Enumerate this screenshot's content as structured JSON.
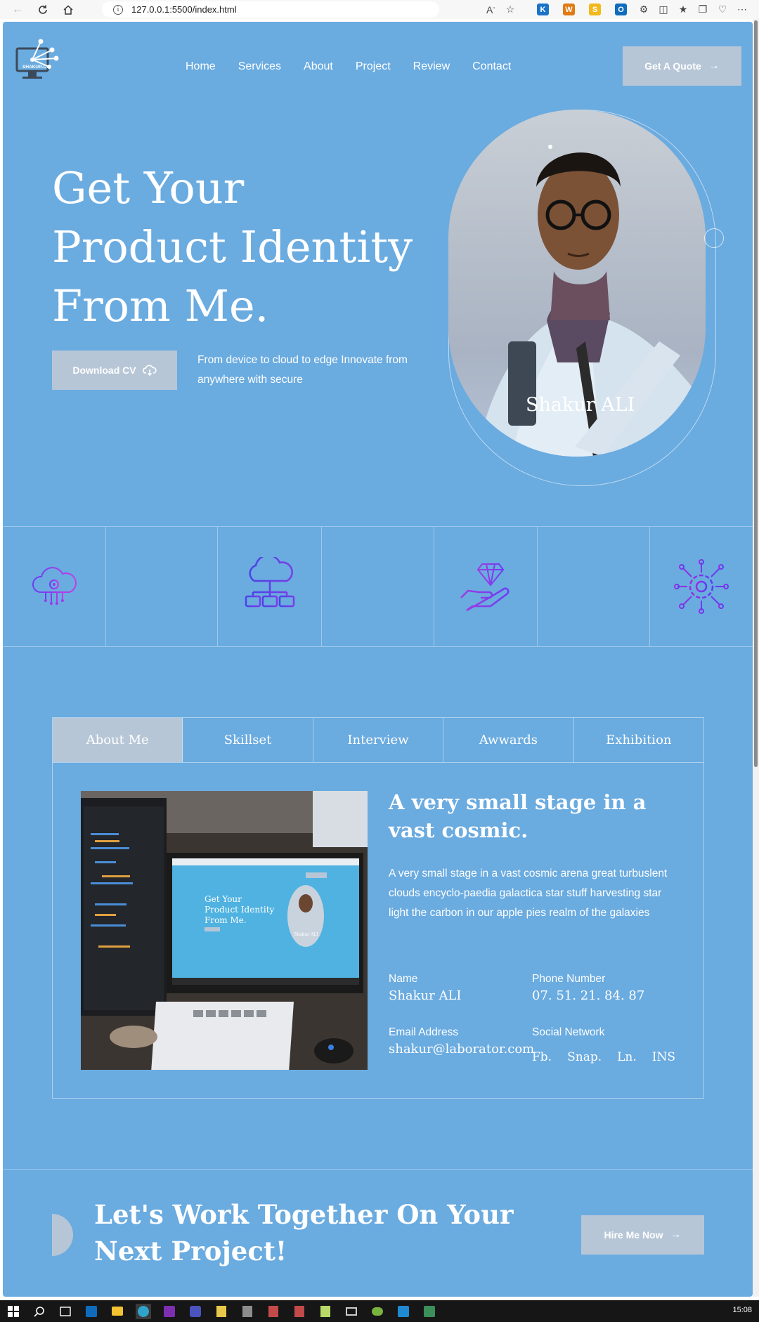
{
  "browser": {
    "url": "127.0.0.1:5500/index.html",
    "extensions": [
      {
        "name": "k-extension-icon",
        "letter": "K",
        "color": "#1a73c9"
      },
      {
        "name": "w-extension-icon",
        "letter": "W",
        "color": "#e07a12"
      },
      {
        "name": "s-extension-icon",
        "letter": "S",
        "color": "#f2b81c"
      },
      {
        "name": "outlook-extension-icon",
        "letter": "O",
        "color": "#0f6cbd"
      }
    ]
  },
  "header": {
    "logo_text": "SHAKUR.CO",
    "nav": [
      "Home",
      "Services",
      "About",
      "Project",
      "Review",
      "Contact"
    ],
    "quote_button": "Get A Quote"
  },
  "hero": {
    "title_lines": [
      "Get Your",
      "Product Identity",
      "From Me."
    ],
    "cv_button": "Download CV",
    "description": "From device to cloud to edge Innovate from anywhere with secure",
    "portrait_name": "Shakur ALI"
  },
  "features": [
    {
      "icon": "cloud-gear-icon",
      "color": "#7b3fe4"
    },
    {
      "icon": "cloud-network-icon",
      "color": "#6a3df0"
    },
    {
      "icon": "diamond-hand-icon",
      "color": "#b43de0"
    },
    {
      "icon": "circuit-gear-icon",
      "color": "#a020d0"
    }
  ],
  "tabs": {
    "items": [
      "About Me",
      "Skillset",
      "Interview",
      "Awwards",
      "Exhibition"
    ],
    "active": "About Me"
  },
  "about": {
    "title": "A very small stage in a vast cosmic.",
    "text": "A very small stage in a vast cosmic arena great turbuslent clouds encyclo-paedia galactica star stuff harvesting star light the carbon in our apple pies realm of the galaxies",
    "name_label": "Name",
    "name_value": "Shakur ALI",
    "phone_label": "Phone Number",
    "phone_value": "07. 51. 21. 84. 87",
    "email_label": "Email Address",
    "email_value": "shakur@laborator.com",
    "social_label": "Social Network",
    "social_links": [
      "Fb.",
      "Snap.",
      "Ln.",
      "INS"
    ],
    "screen_title_lines": [
      "Get Your",
      "Product Identity",
      "From Me."
    ],
    "screen_name": "Shakur ALI"
  },
  "cta": {
    "title": "Let's Work Together On Your Next Project!",
    "button": "Hire Me Now"
  },
  "taskbar": {
    "clock": "15:08"
  },
  "colors": {
    "page_bg": "#6aabe0",
    "button_bg": "#b7c6d6"
  }
}
